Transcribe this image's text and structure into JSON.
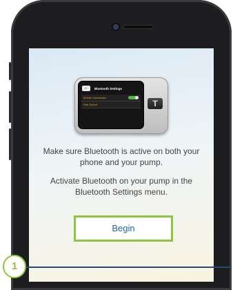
{
  "pump_screen": {
    "back_glyph": "←",
    "title": "Bluetooth Settings",
    "rows": [
      {
        "label": "Mobile Connection"
      },
      {
        "label": "Pair Device"
      }
    ],
    "button_glyph": "T"
  },
  "instructions": [
    "Make sure Bluetooth is active on both your phone and your pump.",
    "Activate Bluetooth on your pump in the Bluetooth Settings menu."
  ],
  "begin_button": "Begin",
  "step_number": "1",
  "colors": {
    "accent_green": "#8cc63f",
    "link_blue": "#2566a8",
    "step_line": "#1f4a7a"
  }
}
